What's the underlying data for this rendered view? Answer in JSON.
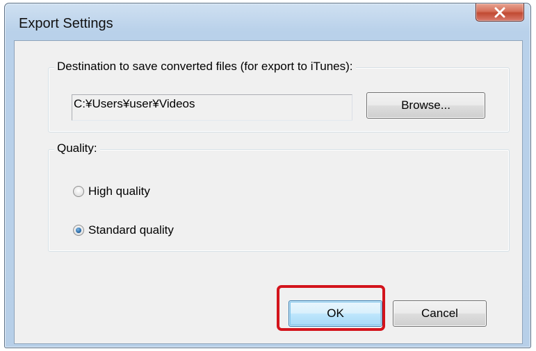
{
  "window": {
    "title": "Export Settings",
    "close_label": "x"
  },
  "destination": {
    "legend": "Destination to save converted files (for export to iTunes):",
    "path_value": "C:¥Users¥user¥Videos",
    "browse_label": "Browse..."
  },
  "quality": {
    "legend": "Quality:",
    "options": [
      {
        "label": "High quality",
        "checked": false
      },
      {
        "label": "Standard quality",
        "checked": true
      }
    ]
  },
  "footer": {
    "ok_label": "OK",
    "cancel_label": "Cancel"
  },
  "colors": {
    "highlight": "#d3141c",
    "close_button": "#c14a32"
  }
}
